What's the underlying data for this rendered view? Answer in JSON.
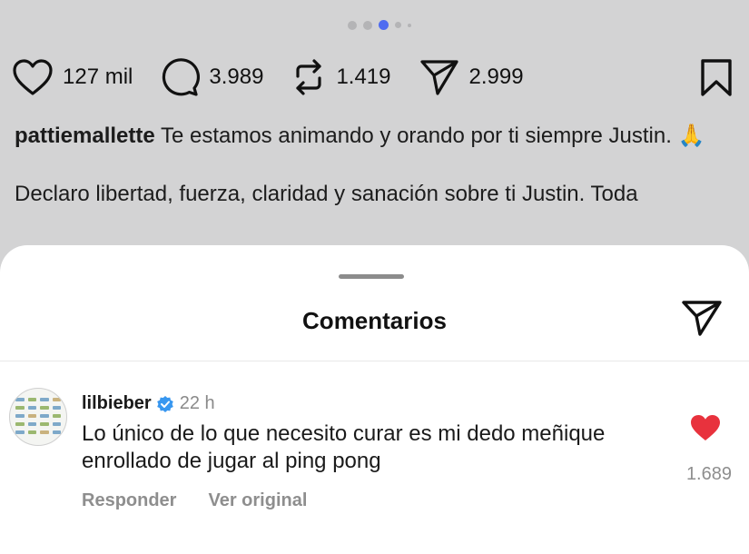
{
  "carousel": {
    "dots": 5,
    "active_index": 2
  },
  "post_actions": {
    "likes": "127 mil",
    "comments": "3.989",
    "reposts": "1.419",
    "shares": "2.999"
  },
  "caption": {
    "username": "pattiemallette",
    "text_1": "Te estamos animando y orando por ti siempre Justin. 🙏",
    "text_2": "Declaro libertad, fuerza, claridad y sanación sobre ti Justin. Toda"
  },
  "comments_sheet": {
    "title": "Comentarios",
    "comments": [
      {
        "username": "lilbieber",
        "verified": true,
        "time": "22 h",
        "text": "Lo único de lo que necesito curar es mi dedo meñique enrollado de jugar al ping pong",
        "likes": "1.689",
        "reply_label": "Responder",
        "see_original_label": "Ver original"
      }
    ]
  },
  "colors": {
    "background": "#d3d3d4",
    "active_dot": "#4f6cf0",
    "heart": "#e8323d",
    "verified": "#3897f0"
  }
}
